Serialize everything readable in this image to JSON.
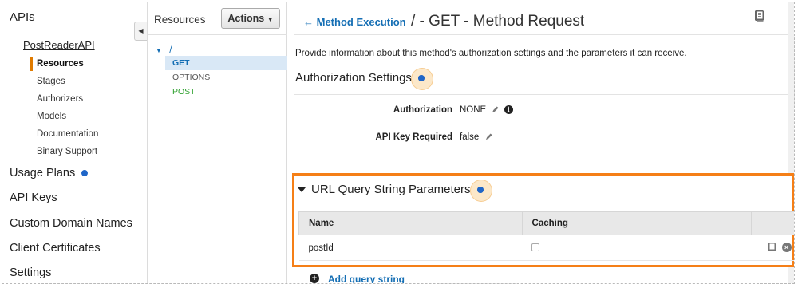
{
  "sidebar": {
    "apis_label": "APIs",
    "api_name": "PostReaderAPI",
    "sub_items": [
      {
        "label": "Resources",
        "active": true
      },
      {
        "label": "Stages"
      },
      {
        "label": "Authorizers"
      },
      {
        "label": "Models"
      },
      {
        "label": "Documentation"
      },
      {
        "label": "Binary Support"
      }
    ],
    "top_items": [
      {
        "label": "Usage Plans"
      },
      {
        "label": "API Keys"
      },
      {
        "label": "Custom Domain Names"
      },
      {
        "label": "Client Certificates"
      },
      {
        "label": "Settings"
      }
    ],
    "collapse_icon": "caret-left-icon"
  },
  "resources": {
    "title": "Resources",
    "actions_label": "Actions",
    "root_path": "/",
    "methods": [
      {
        "label": "GET",
        "selected": true
      },
      {
        "label": "OPTIONS"
      },
      {
        "label": "POST"
      }
    ]
  },
  "main": {
    "back_label": "Method Execution",
    "page_title": "/ - GET - Method Request",
    "description": "Provide information about this method's authorization settings and the parameters it can receive.",
    "auth_heading": "Authorization Settings",
    "authorization_label": "Authorization",
    "authorization_value": "NONE",
    "api_key_label": "API Key Required",
    "api_key_value": "false",
    "query_section": {
      "title": "URL Query String Parameters",
      "columns": [
        "Name",
        "Caching"
      ],
      "rows": [
        {
          "name": "postId",
          "caching": false
        }
      ],
      "add_label": "Add query string"
    }
  },
  "colors": {
    "accent_orange": "#f57f17",
    "link_blue": "#146eb4",
    "post_green": "#2ea02e",
    "dot_blue": "#1f66c8"
  }
}
